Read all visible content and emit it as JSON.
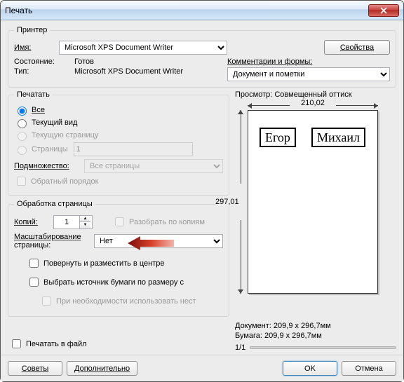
{
  "window": {
    "title": "Печать"
  },
  "printer": {
    "legend": "Принтер",
    "name_label": "Имя:",
    "name_value": "Microsoft XPS Document Writer",
    "props_btn": "Свойства",
    "status_label": "Состояние:",
    "status_value": "Готов",
    "type_label": "Тип:",
    "type_value": "Microsoft XPS Document Writer",
    "commforms_label": "Комментарии и формы:",
    "commforms_value": "Документ и пометки"
  },
  "range": {
    "legend": "Печатать",
    "all": "Все",
    "current_view": "Текущий вид",
    "current_page": "Текущую страницу",
    "pages_label": "Страницы",
    "pages_value": "1",
    "subset_label": "Подмножество:",
    "subset_value": "Все страницы",
    "reverse": "Обратный порядок"
  },
  "handling": {
    "legend": "Обработка страницы",
    "copies_label": "Копий:",
    "copies_value": "1",
    "collate": "Разобрать по копиям",
    "scaling_label1": "Масштабирование",
    "scaling_label2": "страницы:",
    "scaling_value": "Нет",
    "rotate_center": "Повернуть и разместить в центре",
    "paper_source": "Выбрать источник бумаги по размеру с",
    "use_nest": "При необходимости использовать нест"
  },
  "print_to_file": "Печатать в файл",
  "preview": {
    "label": "Просмотр: Совмещенный оттиск",
    "width": "210,02",
    "height": "297,01",
    "box1": "Егор",
    "box2": "Михаил",
    "doc_line": "Документ: 209,9 x 296,7мм",
    "paper_line": "Бумага: 209,9 x 296,7мм",
    "page_indicator": "1/1"
  },
  "footer": {
    "tips": "Советы",
    "advanced": "Дополнительно",
    "ok": "OK",
    "cancel": "Отмена"
  }
}
